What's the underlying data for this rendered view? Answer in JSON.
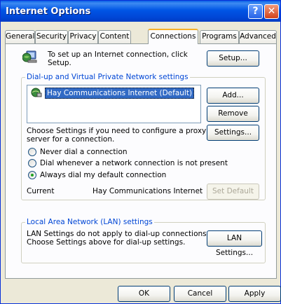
{
  "window": {
    "title": "Internet Options",
    "help_glyph": "?",
    "close_glyph": "✕"
  },
  "tabs": [
    {
      "label": "General"
    },
    {
      "label": "Security"
    },
    {
      "label": "Privacy"
    },
    {
      "label": "Content"
    },
    {
      "label": "Connections",
      "active": true
    },
    {
      "label": "Programs"
    },
    {
      "label": "Advanced"
    }
  ],
  "setup": {
    "text_line1": "To set up an Internet connection, click",
    "text_line2": "Setup.",
    "button": "Setup..."
  },
  "dialup": {
    "group_title": "Dial-up and Virtual Private Network settings",
    "connections": [
      "Hay Communications Internet (Default)"
    ],
    "add_button": "Add...",
    "remove_button": "Remove",
    "proxy_text_line1": "Choose Settings if you need to configure a proxy",
    "proxy_text_line2": "server for a connection.",
    "settings_button": "Settings...",
    "options": [
      {
        "label": "Never dial a connection",
        "selected": false
      },
      {
        "label": "Dial whenever a network connection is not present",
        "selected": false
      },
      {
        "label": "Always dial my default connection",
        "selected": true
      }
    ],
    "current_label": "Current",
    "current_value": "Hay Communications Internet",
    "set_default_button": "Set Default"
  },
  "lan": {
    "group_title": "Local Area Network (LAN) settings",
    "text_line1": "LAN Settings do not apply to dial-up connections.",
    "text_line2": "Choose Settings above for dial-up settings.",
    "button": "LAN Settings..."
  },
  "footer": {
    "ok": "OK",
    "cancel": "Cancel",
    "apply": "Apply"
  },
  "colors": {
    "title_bar": "#0055e5",
    "active_tab_accent": "#f7b028",
    "group_title": "#0046d5",
    "selection": "#316ac5"
  }
}
